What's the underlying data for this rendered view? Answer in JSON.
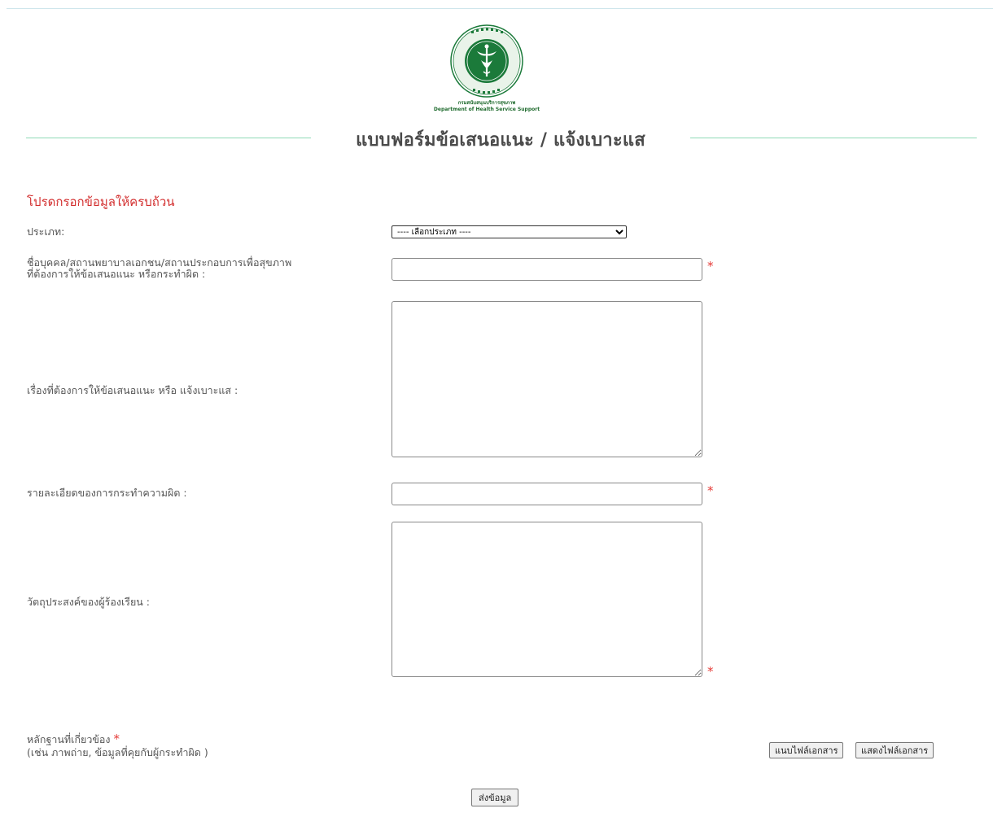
{
  "header": {
    "org_name_th": "กรมสนับสนุนบริการสุขภาพ",
    "org_name_en": "Department of Health Service Support",
    "title": "แบบฟอร์มข้อเสนอแนะ / แจ้งเบาะแส"
  },
  "colors": {
    "accent_line": "#8fd9b6",
    "required": "#e53935",
    "logo_green": "#1b7a3a"
  },
  "form": {
    "required_note": "โปรดกรอกข้อมูลให้ครบถ้วน",
    "type": {
      "label": "ประเภท:",
      "selected": "---- เลือกประเภท ----"
    },
    "person_name": {
      "label_line1": "ชื่อบุคคล/สถานพยาบาลเอกชน/สถานประกอบการเพื่อสุขภาพ",
      "label_line2": "ที่ต้องการให้ข้อเสนอแนะ หรือกระทำผิด :",
      "value": ""
    },
    "subject": {
      "label": "เรื่องที่ต้องการให้ข้อเสนอแนะ หรือ แจ้งเบาะแส :",
      "value": ""
    },
    "details": {
      "label": "รายละเอียดของการกระทำความผิด :",
      "value": ""
    },
    "purpose": {
      "label": "วัตถุประสงค์ของผู้ร้องเรียน :",
      "value": ""
    },
    "evidence": {
      "label": "หลักฐานที่เกี่ยวข้อง",
      "hint": "(เช่น ภาพถ่าย, ข้อมูลที่คุยกับผู้กระทำผิด )",
      "attach_label": "แนบไฟล์เอกสาร",
      "show_label": "แสดงไฟล์เอกสาร"
    },
    "required_mark": "*",
    "submit_label": "ส่งข้อมูล"
  }
}
